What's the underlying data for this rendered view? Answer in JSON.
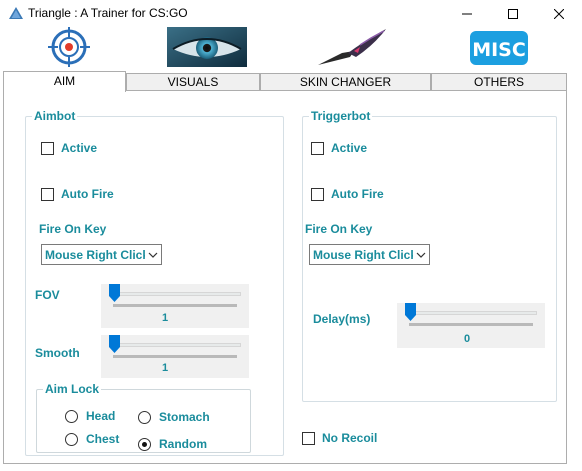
{
  "window": {
    "title": "Triangle : A Trainer for CS:GO"
  },
  "icons": {
    "app": "triangle-icon",
    "aim": "crosshair-icon",
    "visuals": "eye-icon",
    "skin_changer": "knife-icon",
    "misc_text": "MISC"
  },
  "tabs": [
    {
      "label": "AIM",
      "active": true
    },
    {
      "label": "VISUALS",
      "active": false
    },
    {
      "label": "SKIN CHANGER",
      "active": false
    },
    {
      "label": "OTHERS",
      "active": false
    }
  ],
  "aimbot": {
    "title": "Aimbot",
    "active_label": "Active",
    "active_checked": false,
    "autofire_label": "Auto Fire",
    "autofire_checked": false,
    "fire_on_key_label": "Fire On Key",
    "fire_on_key_value": "Mouse Right Click",
    "fov_label": "FOV",
    "fov_value": "1",
    "smooth_label": "Smooth",
    "smooth_value": "1",
    "aim_lock": {
      "title": "Aim Lock",
      "options": [
        "Head",
        "Stomach",
        "Chest",
        "Random"
      ],
      "selected": "Random"
    }
  },
  "triggerbot": {
    "title": "Triggerbot",
    "active_label": "Active",
    "active_checked": false,
    "autofire_label": "Auto Fire",
    "autofire_checked": false,
    "fire_on_key_label": "Fire On Key",
    "fire_on_key_value": "Mouse Right Click",
    "delay_label": "Delay(ms)",
    "delay_value": "0"
  },
  "no_recoil": {
    "label": "No Recoil",
    "checked": false
  },
  "colors": {
    "accent": "#1a8c9c",
    "slider_thumb": "#0078d7"
  }
}
